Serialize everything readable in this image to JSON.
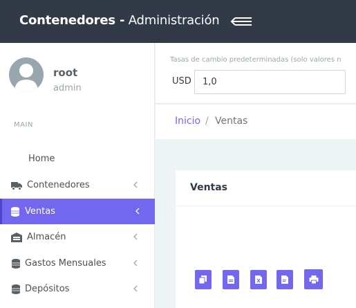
{
  "header": {
    "brand_bold": "Contenedores -",
    "brand_sub": "Administración",
    "menu_icon": "menu-collapse-icon"
  },
  "user": {
    "name": "root",
    "role": "admin",
    "avatar_icon": "user-avatar-icon"
  },
  "sidebar": {
    "section_label": "MAIN",
    "items": [
      {
        "label": "Home",
        "icon": "",
        "active": false
      },
      {
        "label": "Contenedores",
        "icon": "truck-icon",
        "active": false
      },
      {
        "label": "Ventas",
        "icon": "coins-icon",
        "active": true
      },
      {
        "label": "Almacén",
        "icon": "warehouse-icon",
        "active": false
      },
      {
        "label": "Gastos Mensuales",
        "icon": "coins-icon",
        "active": false
      },
      {
        "label": "Depósitos",
        "icon": "coins-icon",
        "active": false
      }
    ]
  },
  "exchange": {
    "caption": "Tasas de cambio predeterminadas (solo valores n",
    "currency": "USD",
    "value": "1,0"
  },
  "breadcrumb": {
    "home": "Inicio",
    "separator": "/",
    "current": "Ventas"
  },
  "card": {
    "title": "Ventas",
    "tools": [
      "copy-icon",
      "csv-icon",
      "excel-icon",
      "pdf-icon",
      "print-icon"
    ]
  },
  "colors": {
    "topbar": "#313a46",
    "accent": "#7367f0",
    "content_bg": "#eef3f6"
  }
}
